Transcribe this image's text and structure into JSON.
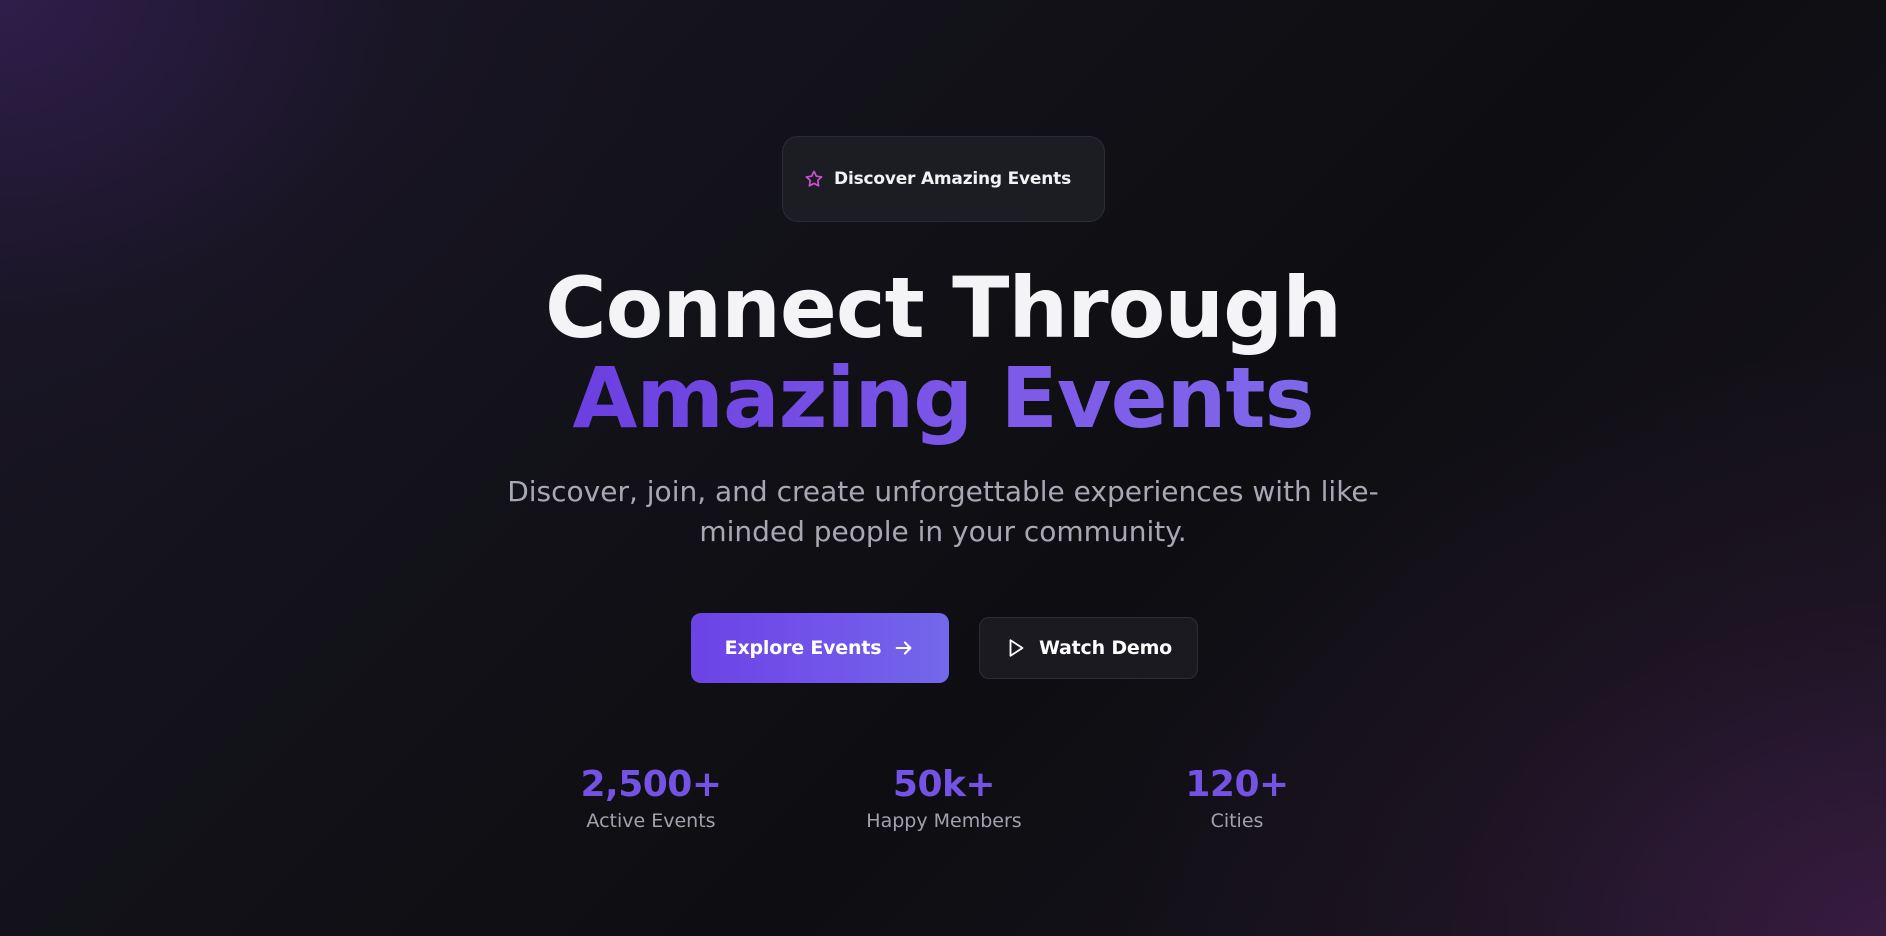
{
  "badge": {
    "icon": "star-icon",
    "text": "Discover Amazing Events",
    "status_color": "#2f7d3b"
  },
  "hero": {
    "title_line1": "Connect Through",
    "title_line2": "Amazing Events",
    "subtitle": "Discover, join, and create unforgettable experiences with like-minded people in your community."
  },
  "actions": {
    "primary": {
      "label": "Explore Events",
      "icon": "arrow-right-icon"
    },
    "secondary": {
      "label": "Watch Demo",
      "icon": "play-icon"
    }
  },
  "stats": [
    {
      "value": "2,500+",
      "label": "Active Events"
    },
    {
      "value": "50k+",
      "label": "Happy Members"
    },
    {
      "value": "120+",
      "label": "Cities"
    }
  ],
  "colors": {
    "accent": "#6c43e6",
    "accent_light": "#7368ea",
    "background": "#0f0e13",
    "star_icon": "#d14fd6"
  }
}
